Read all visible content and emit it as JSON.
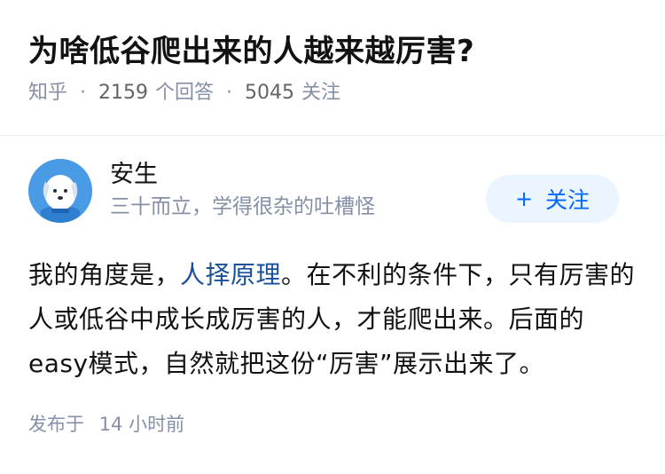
{
  "question": {
    "title": "为啥低谷爬出来的人越来越厉害?",
    "source": "知乎",
    "answer_count": "2159",
    "answer_label": "个回答",
    "follow_count": "5045",
    "follow_label": "关注"
  },
  "answer": {
    "author_name": "安生",
    "author_bio": "三十而立，学得很杂的吐槽怪",
    "follow_button_label": "关注",
    "follow_button_icon": "plus-icon",
    "content_before_link": "我的角度是，",
    "content_link": "人择原理",
    "content_after_link": "。在不利的条件下，只有厉害的人或低谷中成长成厉害的人，才能爬出来。后面的easy模式，自然就把这份“厉害”展示出来了。",
    "published_prefix": "发布于",
    "published_time": "14 小时前"
  },
  "colors": {
    "accent": "#0066ff",
    "link": "#175199",
    "muted": "#8590a6",
    "follow_bg": "#ebf5ff",
    "avatar_bg": "#4a9be6"
  }
}
